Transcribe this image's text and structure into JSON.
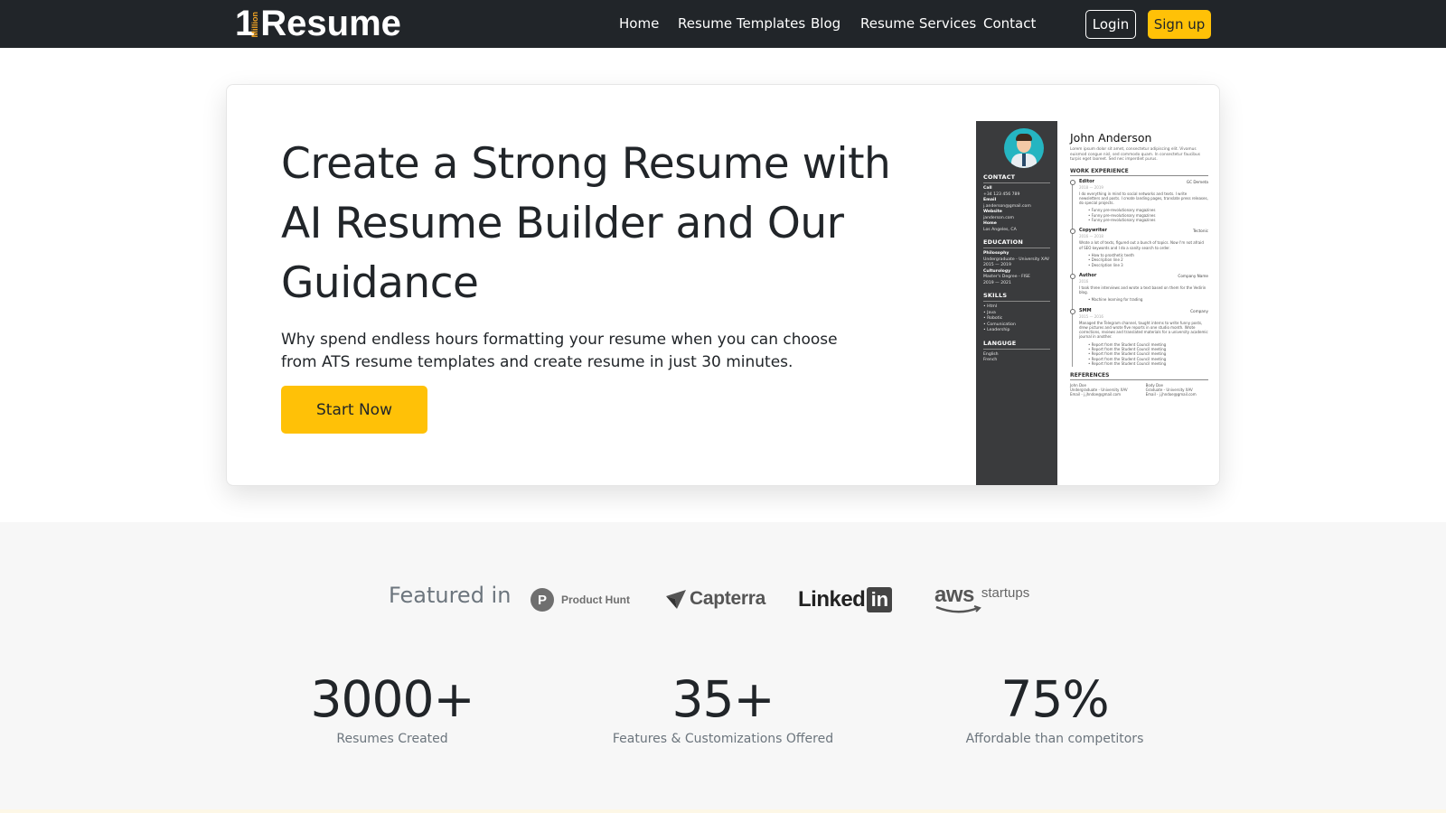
{
  "brand": {
    "number": "1",
    "million": "Million",
    "word": "Resume"
  },
  "nav": {
    "links": [
      "Home",
      "Resume Templates",
      "Blog",
      "Resume Services",
      "Contact"
    ],
    "login": "Login",
    "signup": "Sign up"
  },
  "hero": {
    "title": "Create a Strong Resume with AI Resume Builder and Our Guidance",
    "subtitle": "Why spend endless hours formatting your resume when you can choose from ATS resume templates and create resume in just 30 minutes.",
    "cta": "Start Now"
  },
  "resume_preview": {
    "name": "John Anderson",
    "intro": "Lorem ipsum dolor sit amet, consectetur adipiscing elit. Vivamus euismod congue nisl, sed commodo quam. In consectetur faucibus turpis eget laoreet. Sed nec imperdiet purus.",
    "sidebar": {
      "contact_heading": "CONTACT",
      "contact": [
        {
          "label": "Call",
          "value": "+34 123 456 789"
        },
        {
          "label": "Email",
          "value": "j.anderson@gmail.com"
        },
        {
          "label": "Website",
          "value": "janderson.com"
        },
        {
          "label": "Home",
          "value": "Los Angeles, CA"
        }
      ],
      "education_heading": "EDUCATION",
      "education": [
        {
          "label": "Philosophy",
          "value": "Undergraduate - University XAV",
          "years": "2015 — 2019"
        },
        {
          "label": "Culturology",
          "value": "Master's Degree - FISE",
          "years": "2019 — 2021"
        }
      ],
      "skills_heading": "SKILLS",
      "skills": [
        "Html",
        "Java",
        "Robotic",
        "Comunication",
        "Leadership"
      ],
      "language_heading": "LANGUGE",
      "languages": [
        "English",
        "French"
      ]
    },
    "work_heading": "WORK EXPERIENCE",
    "jobs": [
      {
        "title": "Editor",
        "company": "GC Demeta",
        "date": "2018 — 2019",
        "text": "I do everything in mind to social networks and texts. I write newsletters and posts. I create landing pages, translate press releases, do special projects.",
        "bullets": [
          "Funny pre-revolutionary magazines",
          "Funny pre-revolutionary magazines",
          "Funny pre-revolutionary magazines"
        ]
      },
      {
        "title": "Copywriter",
        "company": "Tectonic",
        "date": "2016 — 2018",
        "text": "Wrote a lot of texts, figured out a bunch of topics. Now I'm not afraid of SEO keywords and I do a sanity search to order.",
        "bullets": [
          "How to prosthetic teeth",
          "Description line 2",
          "Description line 3"
        ]
      },
      {
        "title": "Author",
        "company": "Company Name",
        "date": "2016",
        "text": "I took three interviews and wrote a text based on them for the Vedirin blog.",
        "bullets": [
          "Machine learning for trading"
        ]
      },
      {
        "title": "SMM",
        "company": "Company",
        "date": "2015 — 2016",
        "text": "Managed the Telegram channel, taught interns to write funny posts, drew pictures and wrote five reports in one studio month. Wrote corrections, reviews and translated materials for a university academic journal in another.",
        "bullets": [
          "Report from the Student Council meeting",
          "Report from the Student Council meeting",
          "Report from the Student Council meeting",
          "Report from the Student Council meeting",
          "Report from the Student Council meeting"
        ]
      }
    ],
    "references_heading": "REFERENCES",
    "references": [
      {
        "name": "John Doe",
        "school": "Undergraduate - University XAV",
        "email": "Email - j.jhndoe@gmail.com"
      },
      {
        "name": "Body Doe",
        "school": "Graduate - University XAV",
        "email": "Email - j.jhndoe@gmail.com"
      }
    ]
  },
  "featured": {
    "label": "Featured in",
    "logos": {
      "product_hunt": "Product Hunt",
      "product_hunt_letter": "P",
      "capterra": "Capterra",
      "linkedin_word": "Linked",
      "linkedin_box": "in",
      "aws_word": "aws",
      "aws_startups": "startups"
    }
  },
  "stats": [
    {
      "value": "3000+",
      "label": "Resumes Created"
    },
    {
      "value": "35+",
      "label": "Features & Customizations Offered"
    },
    {
      "value": "75%",
      "label": "Affordable than competitors"
    }
  ],
  "colors": {
    "nav_bg": "#212529",
    "accent": "#ffc107",
    "section_bg": "#f7f7f7",
    "resume_sidebar": "#3a3b3d",
    "avatar_bg": "#25b5c1"
  }
}
